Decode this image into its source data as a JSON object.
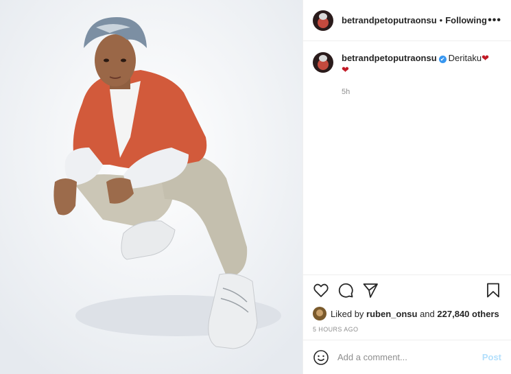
{
  "header": {
    "username": "betrandpetoputraonsu",
    "separator": "•",
    "follow_status": "Following",
    "more_label": "•••"
  },
  "caption": {
    "username": "betrandpetoputraonsu",
    "verified_mark": "✔",
    "text": "Deritaku",
    "heart1": "❤",
    "heart2": "❤",
    "time": "5h"
  },
  "actions": {
    "like_icon": "heart-outline-icon",
    "comment_icon": "comment-icon",
    "share_icon": "paper-plane-icon",
    "save_icon": "bookmark-icon"
  },
  "likes": {
    "prefix": "Liked by",
    "user": "ruben_onsu",
    "middle": "and",
    "count": "227,840 others"
  },
  "timestamp": "5 HOURS AGO",
  "comment_box": {
    "placeholder": "Add a comment...",
    "post_label": "Post",
    "emoji_icon": "smiley-icon"
  },
  "colors": {
    "verified": "#3897f0",
    "post_button": "#b2dffc",
    "heart": "#c21a26",
    "jacket": "#d25a3b"
  }
}
